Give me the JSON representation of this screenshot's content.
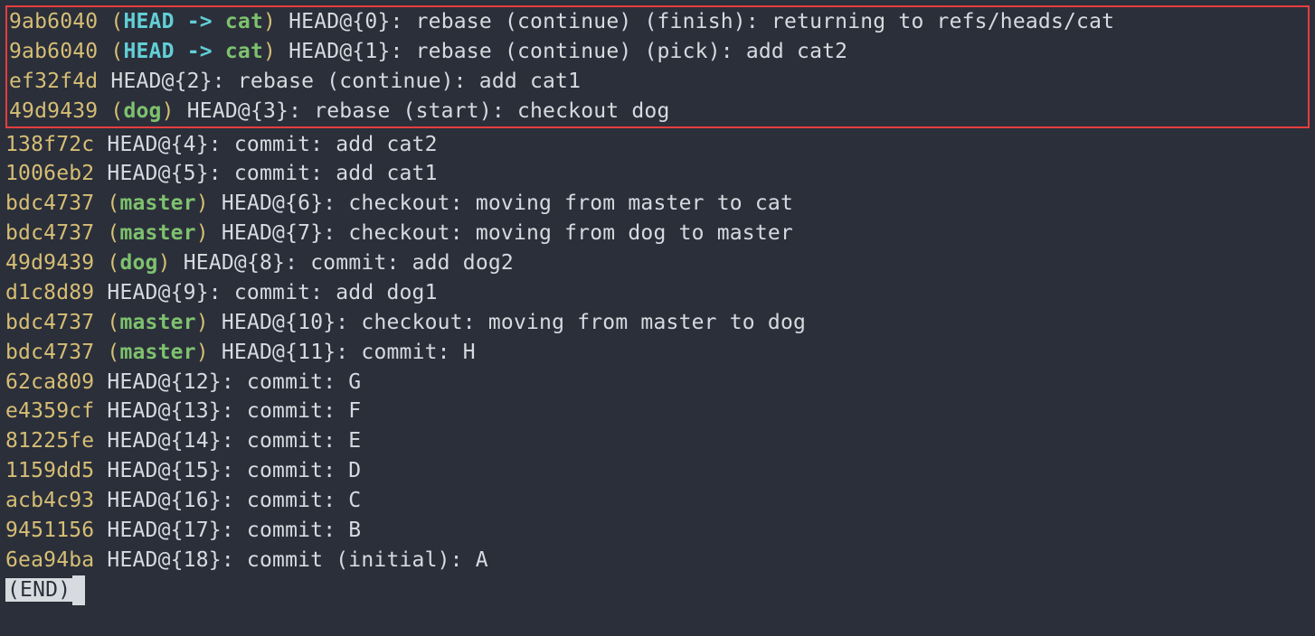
{
  "reflog": {
    "highlighted": [
      {
        "hash": "9ab6040",
        "refs": {
          "head": "HEAD",
          "arrow": " -> ",
          "branch": "cat"
        },
        "position": " HEAD@{0}: ",
        "message": "rebase (continue) (finish): returning to refs/heads/cat"
      },
      {
        "hash": "9ab6040",
        "refs": {
          "head": "HEAD",
          "arrow": " -> ",
          "branch": "cat"
        },
        "position": " HEAD@{1}: ",
        "message": "rebase (continue) (pick): add cat2"
      },
      {
        "hash": "ef32f4d",
        "refs": null,
        "position": " HEAD@{2}: ",
        "message": "rebase (continue): add cat1"
      },
      {
        "hash": "49d9439",
        "refs": {
          "head": null,
          "arrow": null,
          "branch": "dog"
        },
        "position": " HEAD@{3}: ",
        "message": "rebase (start): checkout dog"
      }
    ],
    "entries": [
      {
        "hash": "138f72c",
        "refs": null,
        "position": " HEAD@{4}: ",
        "message": "commit: add cat2"
      },
      {
        "hash": "1006eb2",
        "refs": null,
        "position": " HEAD@{5}: ",
        "message": "commit: add cat1"
      },
      {
        "hash": "bdc4737",
        "refs": {
          "head": null,
          "arrow": null,
          "branch": "master"
        },
        "position": " HEAD@{6}: ",
        "message": "checkout: moving from master to cat"
      },
      {
        "hash": "bdc4737",
        "refs": {
          "head": null,
          "arrow": null,
          "branch": "master"
        },
        "position": " HEAD@{7}: ",
        "message": "checkout: moving from dog to master"
      },
      {
        "hash": "49d9439",
        "refs": {
          "head": null,
          "arrow": null,
          "branch": "dog"
        },
        "position": " HEAD@{8}: ",
        "message": "commit: add dog2"
      },
      {
        "hash": "d1c8d89",
        "refs": null,
        "position": " HEAD@{9}: ",
        "message": "commit: add dog1"
      },
      {
        "hash": "bdc4737",
        "refs": {
          "head": null,
          "arrow": null,
          "branch": "master"
        },
        "position": " HEAD@{10}: ",
        "message": "checkout: moving from master to dog"
      },
      {
        "hash": "bdc4737",
        "refs": {
          "head": null,
          "arrow": null,
          "branch": "master"
        },
        "position": " HEAD@{11}: ",
        "message": "commit: H"
      },
      {
        "hash": "62ca809",
        "refs": null,
        "position": " HEAD@{12}: ",
        "message": "commit: G"
      },
      {
        "hash": "e4359cf",
        "refs": null,
        "position": " HEAD@{13}: ",
        "message": "commit: F"
      },
      {
        "hash": "81225fe",
        "refs": null,
        "position": " HEAD@{14}: ",
        "message": "commit: E"
      },
      {
        "hash": "1159dd5",
        "refs": null,
        "position": " HEAD@{15}: ",
        "message": "commit: D"
      },
      {
        "hash": "acb4c93",
        "refs": null,
        "position": " HEAD@{16}: ",
        "message": "commit: C"
      },
      {
        "hash": "9451156",
        "refs": null,
        "position": " HEAD@{17}: ",
        "message": "commit: B"
      },
      {
        "hash": "6ea94ba",
        "refs": null,
        "position": " HEAD@{18}: ",
        "message": "commit (initial): A"
      }
    ],
    "end_marker": "(END)",
    "paren_open": " (",
    "paren_close": ")"
  }
}
